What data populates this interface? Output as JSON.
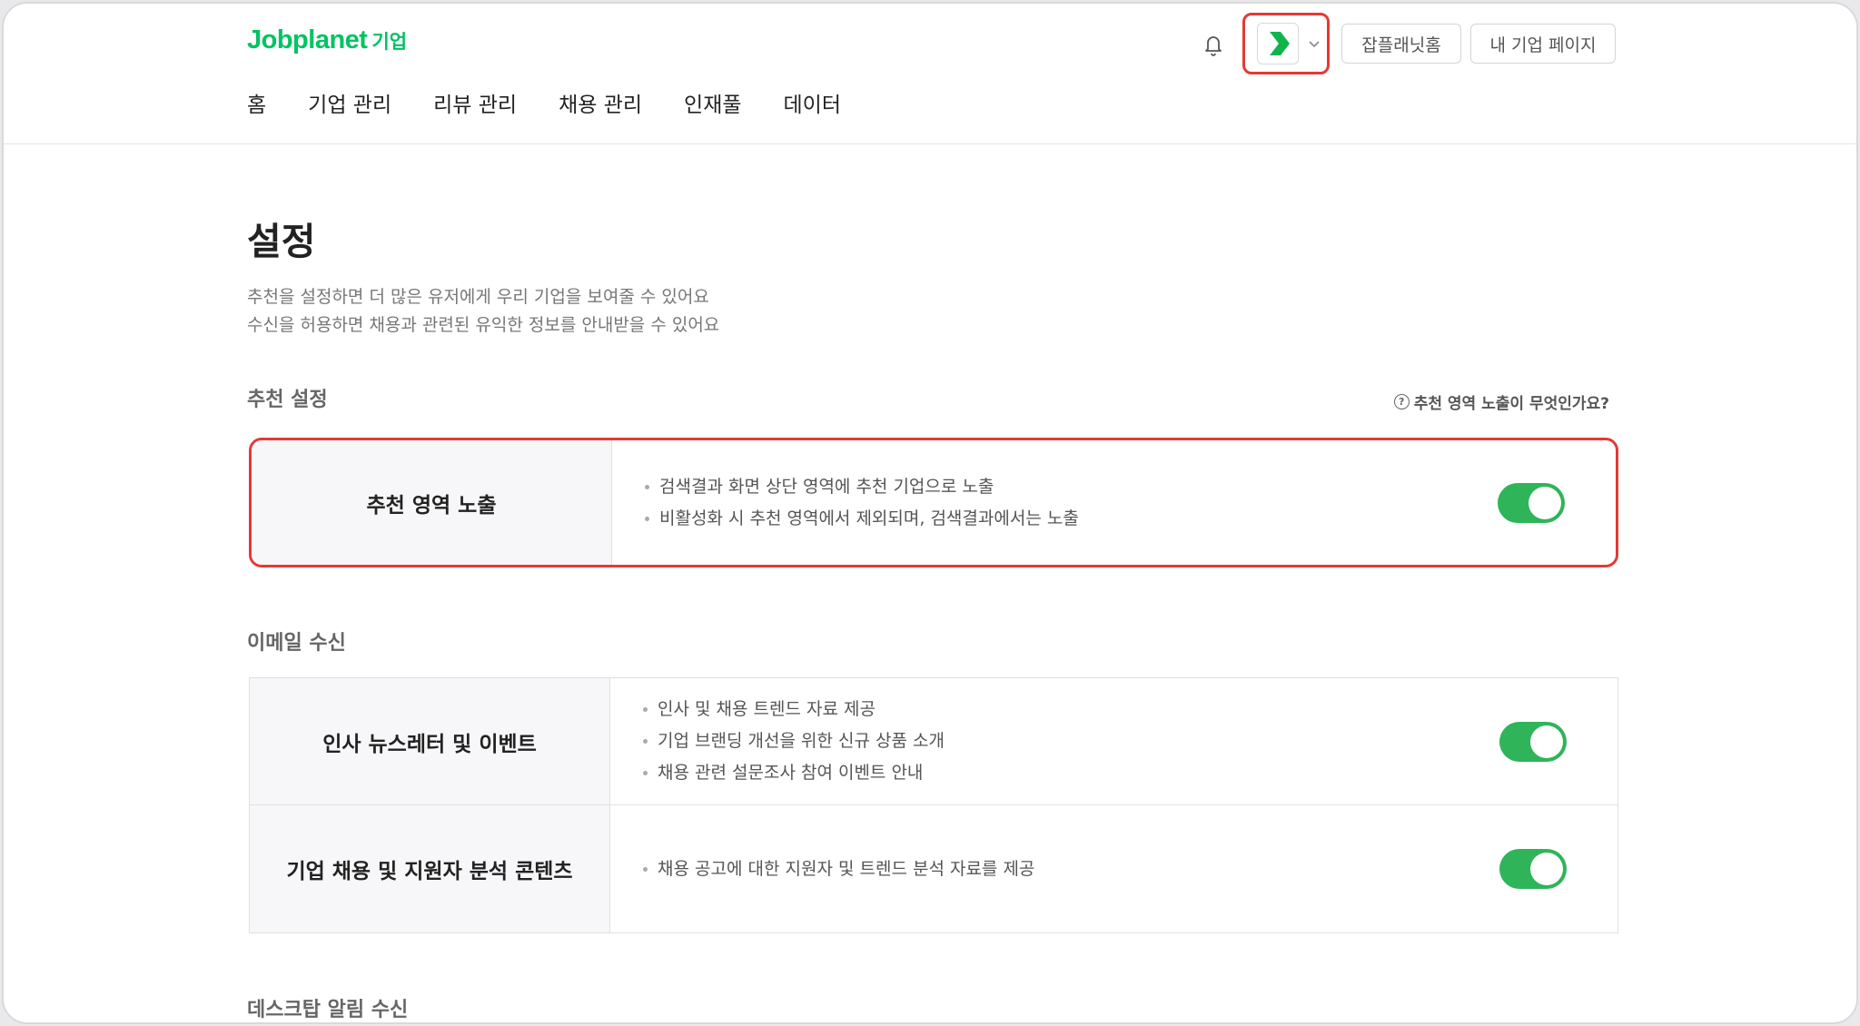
{
  "brand": {
    "name": "Jobplanet",
    "suffix": "기업",
    "color": "#00c362"
  },
  "nav": [
    "홈",
    "기업 관리",
    "리뷰 관리",
    "채용 관리",
    "인재풀",
    "데이터"
  ],
  "header_buttons": {
    "home": "잡플래닛홈",
    "my_page": "내 기업 페이지"
  },
  "icons": {
    "bell": "bell-icon",
    "company": "company-logo-icon",
    "chevron": "chevron-down-icon"
  },
  "page": {
    "title": "설정",
    "desc1": "추천을 설정하면 더 많은 유저에게 우리 기업을 보여줄 수 있어요",
    "desc2": "수신을 허용하면 채용과 관련된 유익한 정보를 안내받을 수 있어요"
  },
  "sections": {
    "recommend": {
      "title": "추천 설정",
      "help": "추천 영역 노출이 무엇인가요?",
      "rows": [
        {
          "label": "추천 영역 노출",
          "bullets": [
            "검색결과 화면 상단 영역에 추천 기업으로 노출",
            "비활성화 시 추천 영역에서 제외되며, 검색결과에서는 노출"
          ],
          "enabled": true
        }
      ]
    },
    "email": {
      "title": "이메일 수신",
      "rows": [
        {
          "label": "인사 뉴스레터 및 이벤트",
          "bullets": [
            "인사 및 채용 트렌드 자료 제공",
            "기업 브랜딩 개선을 위한 신규 상품 소개",
            "채용 관련 설문조사 참여 이벤트 안내"
          ],
          "enabled": true
        },
        {
          "label": "기업 채용 및 지원자 분석 콘텐츠",
          "bullets": [
            "채용 공고에 대한 지원자 및 트렌드 분석 자료를 제공"
          ],
          "enabled": true
        }
      ]
    },
    "desktop": {
      "title": "데스크탑 알림 수신"
    }
  },
  "colors": {
    "toggle_on": "#2fb45a",
    "highlight": "#e53935"
  }
}
